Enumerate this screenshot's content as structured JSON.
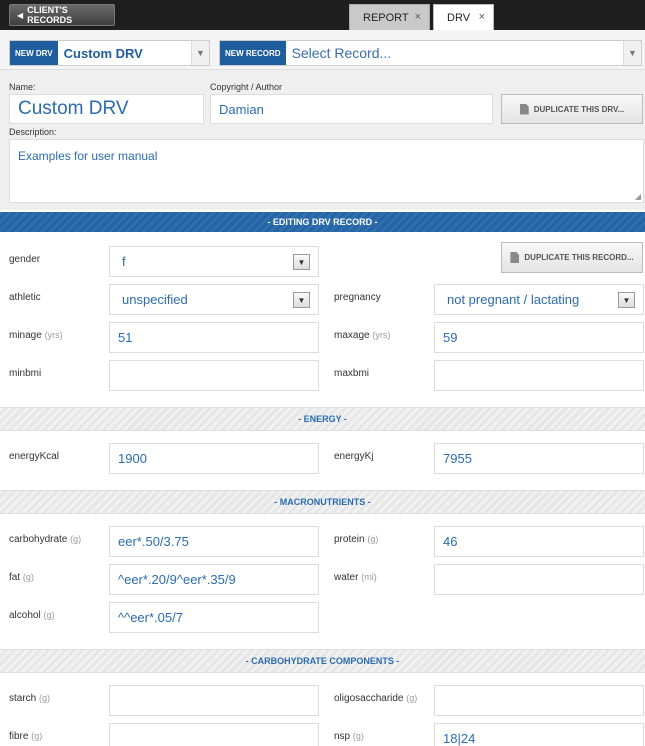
{
  "topbar": {
    "back_label": "CLIENT'S RECORDS",
    "tabs": [
      {
        "label": "REPORT",
        "close": "×"
      },
      {
        "label": "DRV",
        "close": "×"
      }
    ]
  },
  "recordbar": {
    "new_drv_label": "NEW DRV",
    "drv_selected": "Custom DRV",
    "new_record_label": "NEW RECORD",
    "record_placeholder": "Select Record..."
  },
  "header": {
    "name_label": "Name:",
    "name_value": "Custom DRV",
    "author_label": "Copyright / Author",
    "author_value": "Damian",
    "duplicate_drv_label": "DUPLICATE THIS DRV...",
    "description_label": "Description:",
    "description_value": "Examples for user manual"
  },
  "editing": {
    "title": "- EDITING DRV RECORD -",
    "duplicate_record_label": "DUPLICATE THIS RECORD...",
    "gender_label": "gender",
    "gender_value": "f",
    "athletic_label": "athletic",
    "athletic_value": "unspecified",
    "pregnancy_label": "pregnancy",
    "pregnancy_value": "not pregnant / lactating",
    "minage_label": "minage",
    "minage_unit": "(yrs)",
    "minage_value": "51",
    "maxage_label": "maxage",
    "maxage_unit": "(yrs)",
    "maxage_value": "59",
    "minbmi_label": "minbmi",
    "minbmi_value": "",
    "maxbmi_label": "maxbmi",
    "maxbmi_value": ""
  },
  "energy": {
    "title": "- ENERGY -",
    "kcal_label": "energyKcal",
    "kcal_value": "1900",
    "kj_label": "energyKj",
    "kj_value": "7955"
  },
  "macro": {
    "title": "- MACRONUTRIENTS -",
    "carb_label": "carbohydrate",
    "carb_unit": "(g)",
    "carb_value": "eer*.50/3.75",
    "protein_label": "protein",
    "protein_unit": "(g)",
    "protein_value": "46",
    "fat_label": "fat",
    "fat_unit": "(g)",
    "fat_value": "^eer*.20/9^eer*.35/9",
    "water_label": "water",
    "water_unit": "(ml)",
    "water_value": "",
    "alcohol_label": "alcohol",
    "alcohol_unit": "(g)",
    "alcohol_value": "^^eer*.05/7"
  },
  "carbcomp": {
    "title": "- CARBOHYDRATE COMPONENTS -",
    "starch_label": "starch",
    "starch_unit": "(g)",
    "starch_value": "",
    "oligo_label": "oligosaccharide",
    "oligo_unit": "(g)",
    "oligo_value": "",
    "fibre_label": "fibre",
    "fibre_unit": "(g)",
    "fibre_value": "",
    "nsp_label": "nsp",
    "nsp_unit": "(g)",
    "nsp_value": "18|24"
  },
  "colors": {
    "accent": "#1f5e9e",
    "value_text": "#2b6cb0",
    "topbar_bg": "#1e1e1e"
  }
}
